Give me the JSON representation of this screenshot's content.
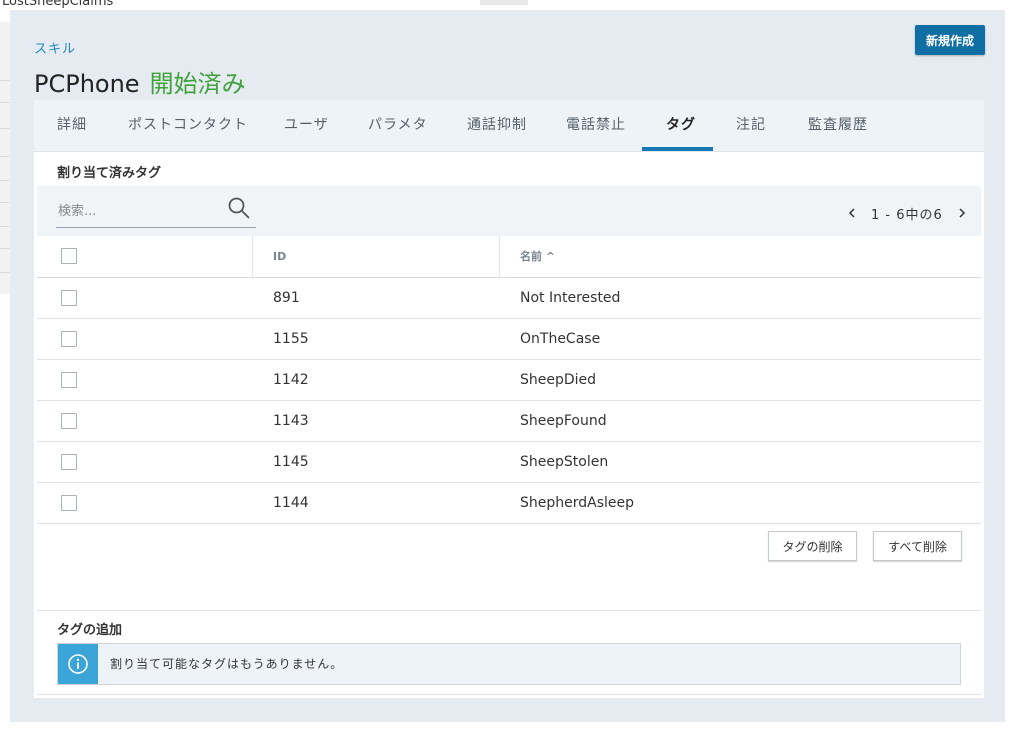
{
  "background": {
    "window_title": "LostSheepClaims"
  },
  "breadcrumb": "スキル",
  "title": {
    "name": "PCPhone",
    "status": "開始済み",
    "status_color": "#3ea23a"
  },
  "new_button_label": "新規作成",
  "tabs": [
    {
      "label": "詳細",
      "active": false
    },
    {
      "label": "ポストコンタクト",
      "active": false
    },
    {
      "label": "ユーザ",
      "active": false
    },
    {
      "label": "パラメタ",
      "active": false
    },
    {
      "label": "通話抑制",
      "active": false
    },
    {
      "label": "電話禁止",
      "active": false
    },
    {
      "label": "タグ",
      "active": true
    },
    {
      "label": "注記",
      "active": false
    },
    {
      "label": "監査履歴",
      "active": false
    }
  ],
  "assigned": {
    "heading": "割り当て済みタグ",
    "search_placeholder": "検索...",
    "search_icon": "search-icon",
    "pager_text": "1 - 6中の6",
    "columns": {
      "id": "ID",
      "name": "名前 ^"
    },
    "rows": [
      {
        "id": "891",
        "name": "Not Interested"
      },
      {
        "id": "1155",
        "name": "OnTheCase"
      },
      {
        "id": "1142",
        "name": "SheepDied"
      },
      {
        "id": "1143",
        "name": "SheepFound"
      },
      {
        "id": "1145",
        "name": "SheepStolen"
      },
      {
        "id": "1144",
        "name": "ShepherdAsleep"
      }
    ],
    "delete_button": "タグの削除",
    "delete_all_button": "すべて削除"
  },
  "add": {
    "heading": "タグの追加",
    "info_icon": "info-icon",
    "message": "割り当て可能なタグはもうありません。"
  },
  "colors": {
    "accent": "#1478b4",
    "primary_button": "#0f6ea3",
    "info": "#3aa5d6",
    "modal_bg": "#e5ebf1"
  }
}
